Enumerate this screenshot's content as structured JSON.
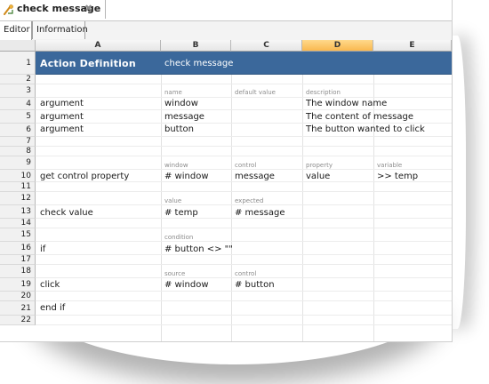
{
  "document_tab": {
    "title": "check message",
    "close_glyph": "✖",
    "icon": "action-icon"
  },
  "sub_tabs": [
    {
      "label": "Editor",
      "active": true
    },
    {
      "label": "Information",
      "active": false
    }
  ],
  "grid": {
    "columns": [
      "A",
      "B",
      "C",
      "D",
      "E"
    ],
    "selected_column": "D",
    "rows": [
      "1",
      "2",
      "3",
      "4",
      "5",
      "6",
      "7",
      "8",
      "9",
      "10",
      "11",
      "12",
      "13",
      "14",
      "15",
      "16",
      "17",
      "18",
      "19",
      "20",
      "21",
      "22"
    ]
  },
  "action_definition": {
    "title": "Action Definition",
    "name": "check message"
  },
  "argument_headers": {
    "name": "name",
    "default_value": "default value",
    "description": "description"
  },
  "arguments": [
    {
      "keyword": "argument",
      "name": "window",
      "description": "The window name"
    },
    {
      "keyword": "argument",
      "name": "message",
      "description": "The content of message"
    },
    {
      "keyword": "argument",
      "name": "button",
      "description": "The button wanted to click"
    }
  ],
  "steps": {
    "get_control_property": {
      "headers": {
        "window": "window",
        "control": "control",
        "property": "property",
        "variable": "variable"
      },
      "keyword": "get control property",
      "window": "# window",
      "control": "message",
      "property": "value",
      "variable": ">> temp"
    },
    "check_value": {
      "headers": {
        "value": "value",
        "expected": "expected"
      },
      "keyword": "check value",
      "value": "# temp",
      "expected": "# message"
    },
    "if": {
      "header": "condition",
      "keyword": "if",
      "condition": "# button <> \"\""
    },
    "click": {
      "headers": {
        "source": "source",
        "control": "control"
      },
      "keyword": "click",
      "source": "# window",
      "control": "# button"
    },
    "end_if": {
      "keyword": "end if"
    }
  },
  "colors": {
    "title_row": "#3b689b",
    "selected_column": "#f9b84f"
  }
}
